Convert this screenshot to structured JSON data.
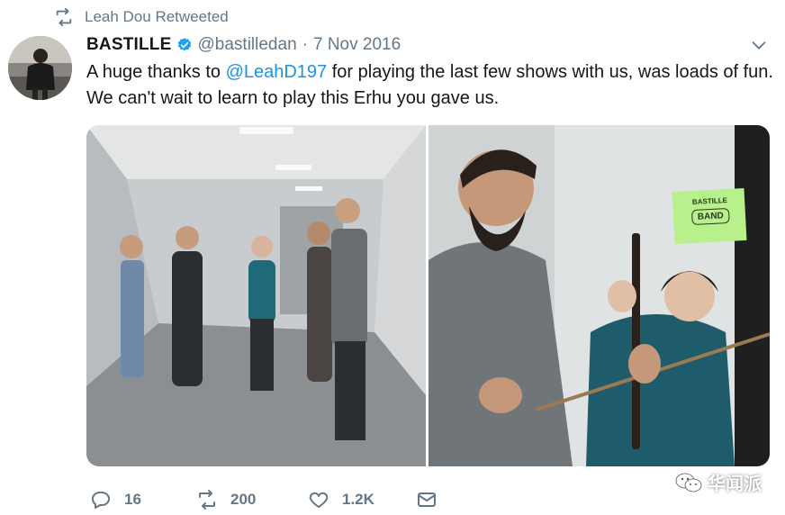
{
  "retweet_context": {
    "label": "Leah Dou Retweeted",
    "icon": "retweet-icon"
  },
  "tweet": {
    "author_name": "BASTILLE",
    "author_verified": true,
    "handle": "@bastilledan",
    "separator": "·",
    "date": "7 Nov 2016",
    "text_before": "A huge thanks to ",
    "mention": "@LeahD197",
    "text_after": " for playing the last few shows with us, was loads of fun. We can't wait to learn to play this Erhu you gave us."
  },
  "media": {
    "photos": [
      {
        "description_icon": "band-hallway-photo"
      },
      {
        "description_icon": "erhu-photo",
        "sign_line1": "BASTILLE",
        "sign_line2": "BAND"
      }
    ]
  },
  "actions": {
    "reply_count": "16",
    "retweet_count": "200",
    "like_count": "1.2K"
  },
  "watermark": {
    "text": "华闻派"
  },
  "colors": {
    "accent": "#1b95e0",
    "muted": "#657786",
    "text": "#14171a"
  }
}
